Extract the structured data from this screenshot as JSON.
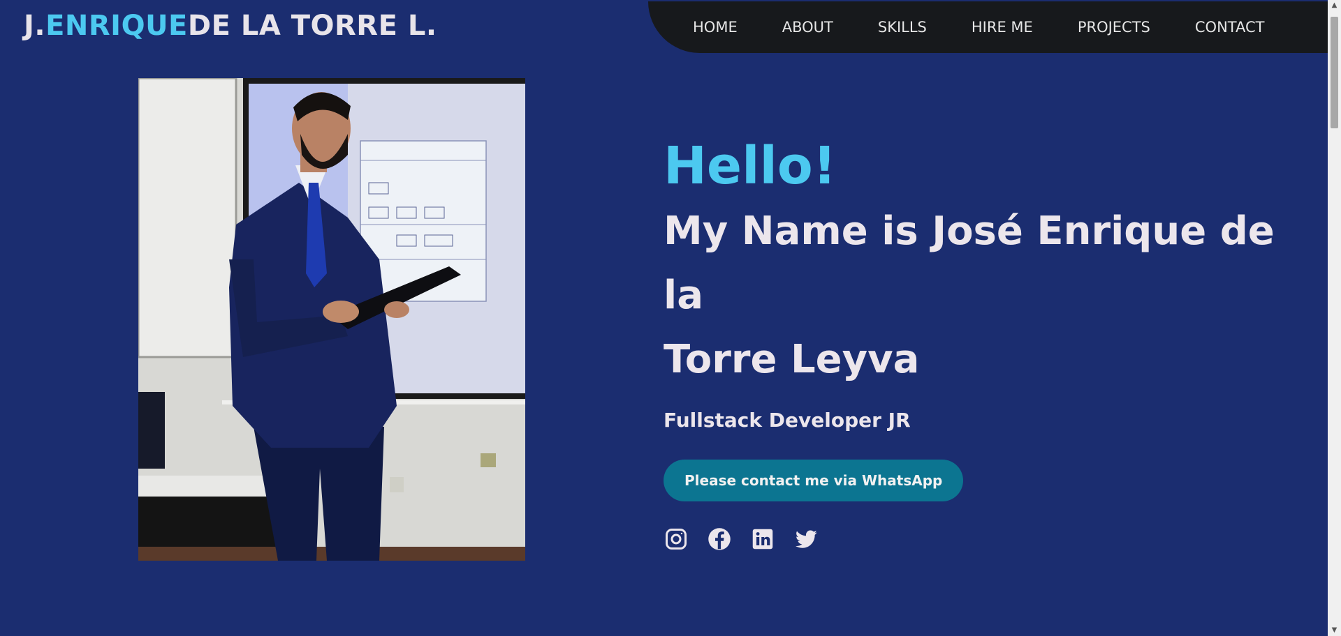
{
  "logo": {
    "part1": "J.",
    "part2": "ENRIQUE",
    "part3": "DE LA TORRE L."
  },
  "nav": {
    "items": [
      {
        "label": "HOME"
      },
      {
        "label": "ABOUT"
      },
      {
        "label": "SKILLS"
      },
      {
        "label": "HIRE ME"
      },
      {
        "label": "PROJECTS"
      },
      {
        "label": "CONTACT"
      }
    ]
  },
  "hero": {
    "greeting": "Hello!",
    "name_line1": "My Name is José Enrique de la",
    "name_line2": "Torre Leyva",
    "role": "Fullstack Developer JR",
    "cta_label": "Please contact me via WhatsApp",
    "photo_icon": "presenter-photo"
  },
  "socials": [
    {
      "icon": "instagram-icon"
    },
    {
      "icon": "facebook-icon"
    },
    {
      "icon": "linkedin-icon"
    },
    {
      "icon": "twitter-icon"
    }
  ],
  "colors": {
    "background": "#1b2d70",
    "accent": "#4cc9f0",
    "nav_background": "#17191c",
    "button": "#0c7591",
    "text": "#ece6ec"
  }
}
